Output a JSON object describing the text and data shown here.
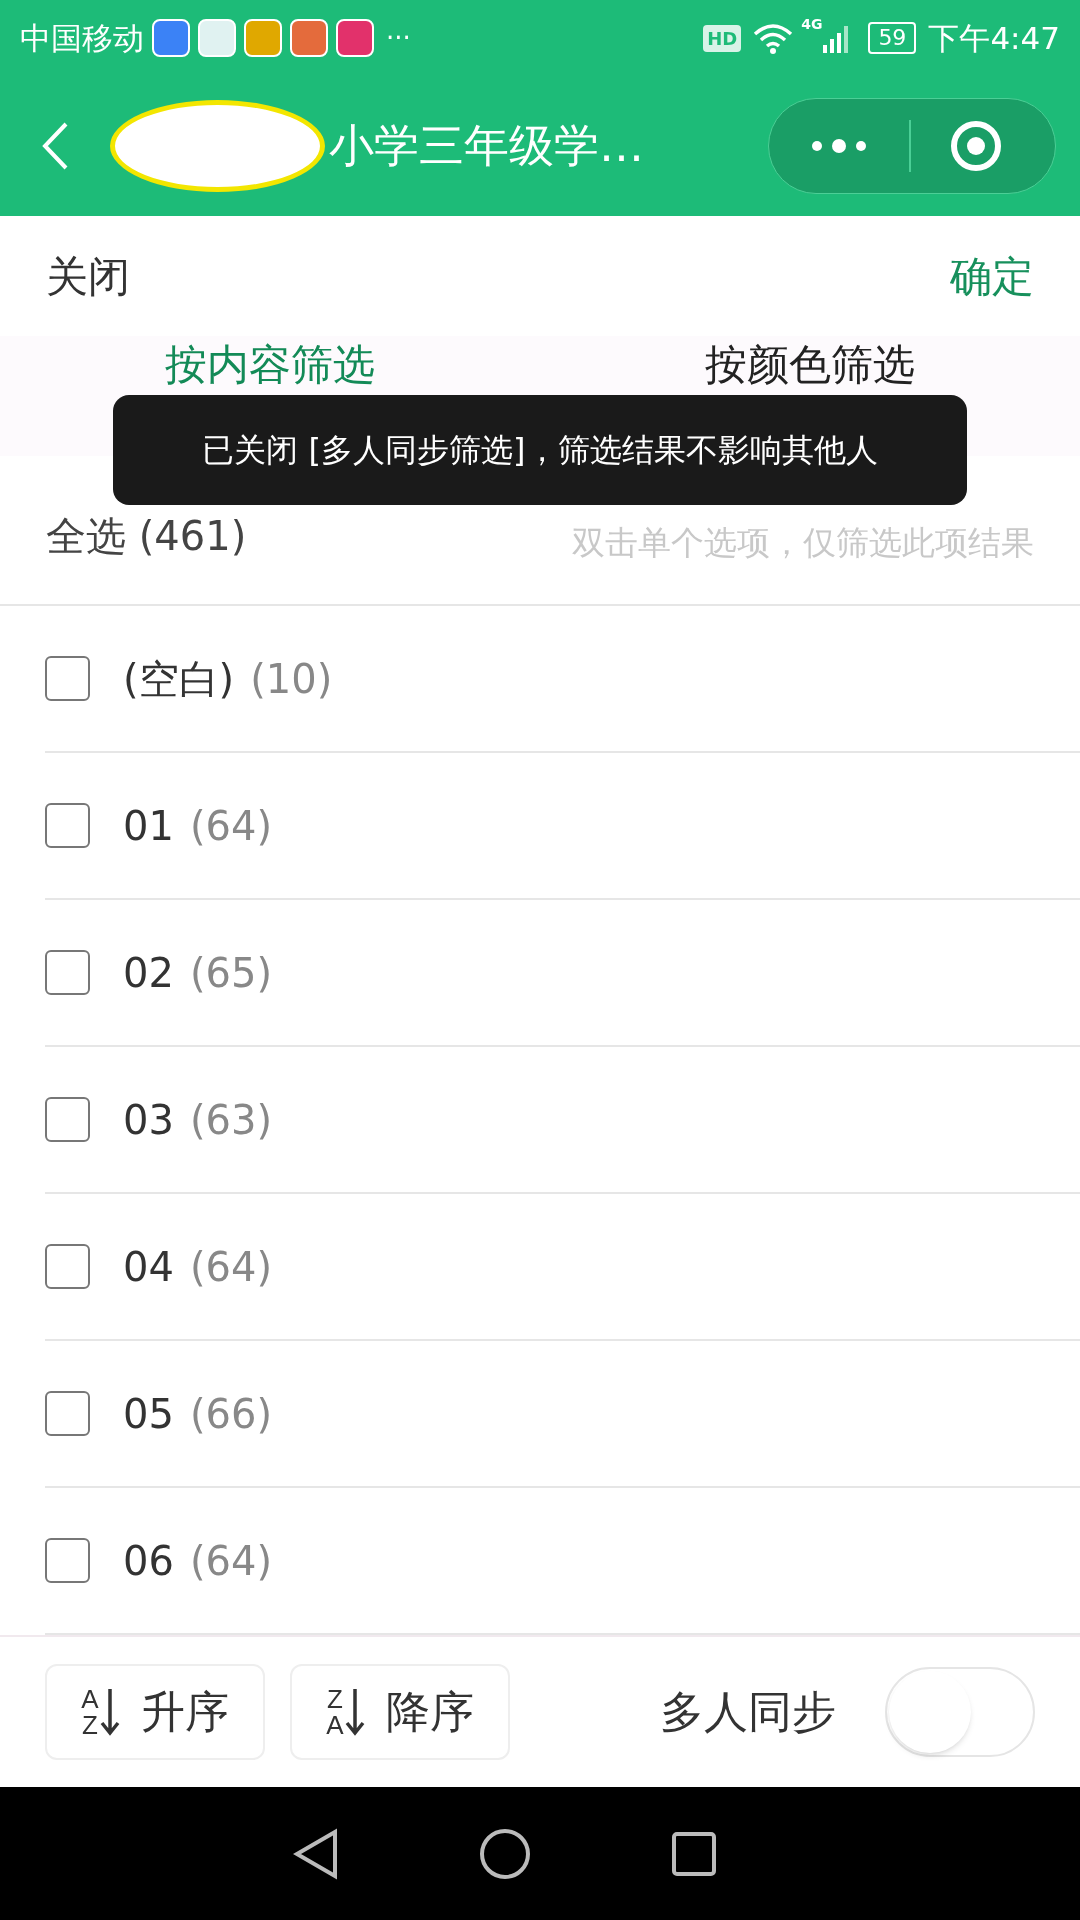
{
  "status_bar": {
    "carrier": "中国移动",
    "more": "···",
    "hd": "HD",
    "network": "4G",
    "battery": "59",
    "time": "下午4:47"
  },
  "header": {
    "title": "小学三年级学…",
    "redacted": true
  },
  "toolbar": {
    "close": "关闭",
    "confirm": "确定"
  },
  "tabs": [
    {
      "label": "按内容筛选",
      "selected": true
    },
    {
      "label": "按颜色筛选",
      "selected": false
    }
  ],
  "toast": "已关闭 [多人同步筛选]，筛选结果不影响其他人",
  "select_all": {
    "label": "全选",
    "count": "(461)",
    "hint": "双击单个选项，仅筛选此项结果"
  },
  "items": [
    {
      "label": "(空白)",
      "count": "(10)",
      "checked": false
    },
    {
      "label": "01",
      "count": "(64)",
      "checked": false
    },
    {
      "label": "02",
      "count": "(65)",
      "checked": false
    },
    {
      "label": "03",
      "count": "(63)",
      "checked": false
    },
    {
      "label": "04",
      "count": "(64)",
      "checked": false
    },
    {
      "label": "05",
      "count": "(66)",
      "checked": false
    },
    {
      "label": "06",
      "count": "(64)",
      "checked": false
    }
  ],
  "sort_buttons": [
    {
      "top": "A",
      "bottom": "Z",
      "label": "升序"
    },
    {
      "top": "Z",
      "bottom": "A",
      "label": "降序"
    }
  ],
  "sync": {
    "label": "多人同步",
    "on": false
  }
}
